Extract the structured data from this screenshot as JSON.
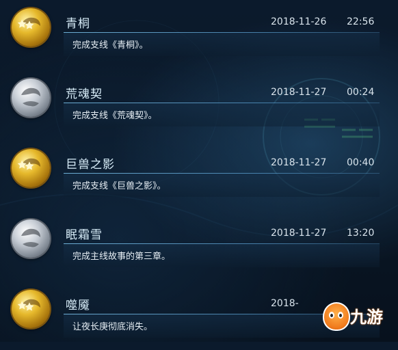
{
  "entries": [
    {
      "title": "青桐",
      "date": "2018-11-26",
      "time": "22:56",
      "description": "完成支线《青桐》。",
      "medal": "gold"
    },
    {
      "title": "荒魂契",
      "date": "2018-11-27",
      "time": "00:24",
      "description": "完成支线《荒魂契》。",
      "medal": "silver"
    },
    {
      "title": "巨兽之影",
      "date": "2018-11-27",
      "time": "00:40",
      "description": "完成支线《巨兽之影》。",
      "medal": "gold"
    },
    {
      "title": "眠霜雪",
      "date": "2018-11-27",
      "time": "13:20",
      "description": "完成主线故事的第三章。",
      "medal": "silver"
    },
    {
      "title": "噬魇",
      "date": "2018-",
      "time": "",
      "description": "让夜长庚彻底消失。",
      "medal": "gold"
    }
  ],
  "watermark": {
    "text": "九游",
    "icon": "jiuyou-mascot-icon"
  },
  "colors": {
    "gold": "#e6b92c",
    "silver": "#c8ced6",
    "divider": "#78bee6",
    "background": "#0a1726"
  }
}
